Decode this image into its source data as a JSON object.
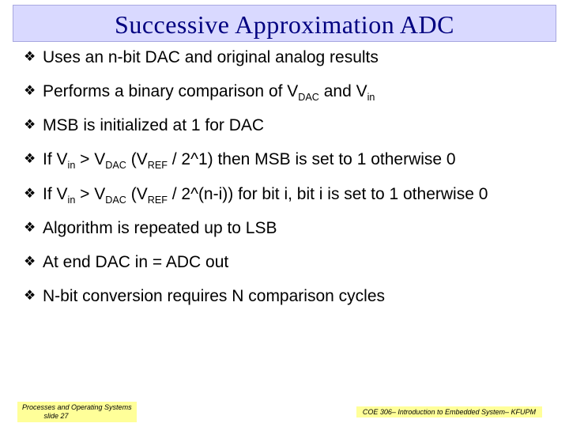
{
  "slide": {
    "title": "Successive Approximation ADC",
    "bullets": [
      {
        "pre": "Uses an n-bit DAC and original analog results",
        "sub": "",
        "post": ""
      },
      {
        "pre": "Performs a binary comparison of V",
        "sub": "DAC",
        "post": "  and V",
        "sub2": "in",
        "post2": ""
      },
      {
        "pre": "MSB is initialized at 1 for DAC",
        "sub": "",
        "post": ""
      },
      {
        "pre": "If V",
        "sub": "in",
        "post": " > V",
        "sub2": "DAC",
        "post2": " (V",
        "sub3": "REF",
        "post3": " / 2^1) then MSB is set to 1 otherwise 0"
      },
      {
        "pre": "If V",
        "sub": "in",
        "post": " > V",
        "sub2": "DAC",
        "post2": " (V",
        "sub3": "REF",
        "post3": " / 2^(n-i))  for bit i, bit i is set to 1 otherwise 0"
      },
      {
        "pre": "Algorithm is repeated up to LSB",
        "sub": "",
        "post": ""
      },
      {
        "pre": "At end DAC in = ADC out",
        "sub": "",
        "post": ""
      },
      {
        "pre": "N-bit conversion requires N comparison cycles",
        "sub": "",
        "post": ""
      }
    ]
  },
  "footer": {
    "left_line1": "Processes and Operating Systems",
    "left_line2": "slide 27",
    "right": "COE 306– Introduction to Embedded System– KFUPM"
  }
}
